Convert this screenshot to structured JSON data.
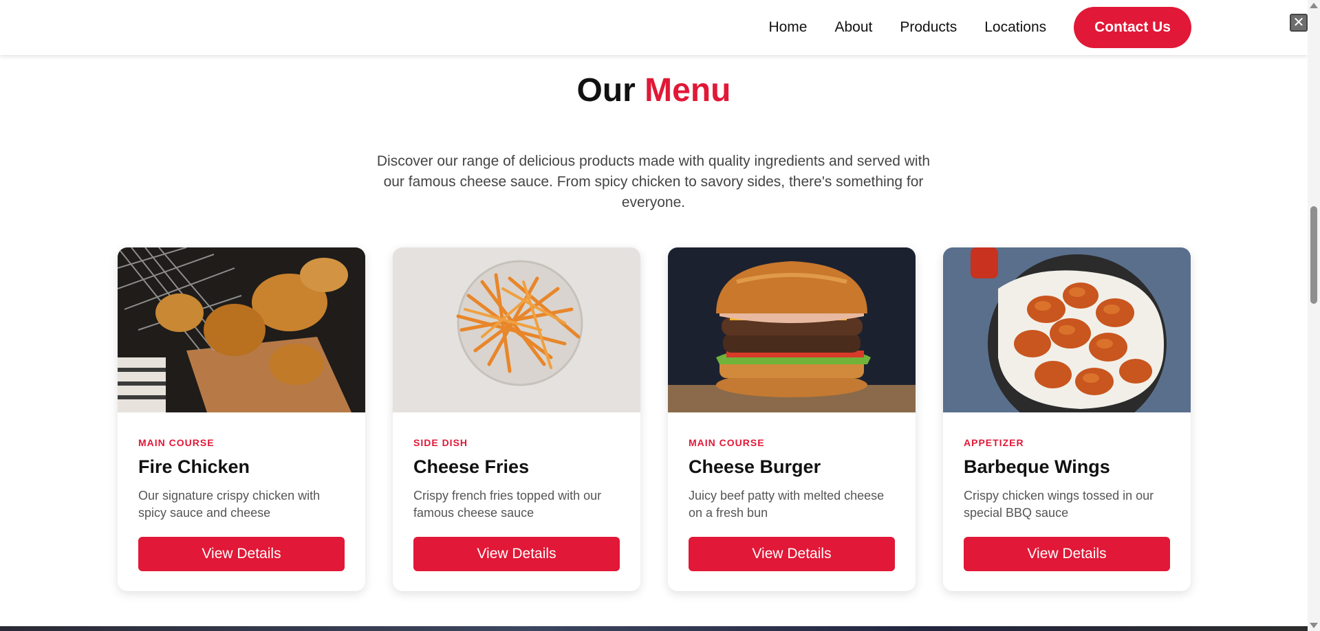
{
  "nav": {
    "items": [
      "Home",
      "About",
      "Products",
      "Locations"
    ],
    "contact_label": "Contact Us"
  },
  "section": {
    "title_main": "Our",
    "title_accent": "Menu",
    "intro": "Discover our range of delicious products made with quality ingredients and served with our famous cheese sauce. From spicy chicken to savory sides, there's something for everyone."
  },
  "cards": [
    {
      "category": "MAIN COURSE",
      "title": "Fire Chicken",
      "description": "Our signature crispy chicken with spicy sauce and cheese",
      "button": "View Details"
    },
    {
      "category": "SIDE DISH",
      "title": "Cheese Fries",
      "description": "Crispy french fries topped with our famous cheese sauce",
      "button": "View Details"
    },
    {
      "category": "MAIN COURSE",
      "title": "Cheese Burger",
      "description": "Juicy beef patty with melted cheese on a fresh bun",
      "button": "View Details"
    },
    {
      "category": "APPETIZER",
      "title": "Barbeque Wings",
      "description": "Crispy chicken wings tossed in our special BBQ sauce",
      "button": "View Details"
    }
  ],
  "colors": {
    "accent": "#e11837",
    "text": "#111111",
    "muted": "#555555"
  },
  "icons": {
    "close": "close-icon"
  }
}
